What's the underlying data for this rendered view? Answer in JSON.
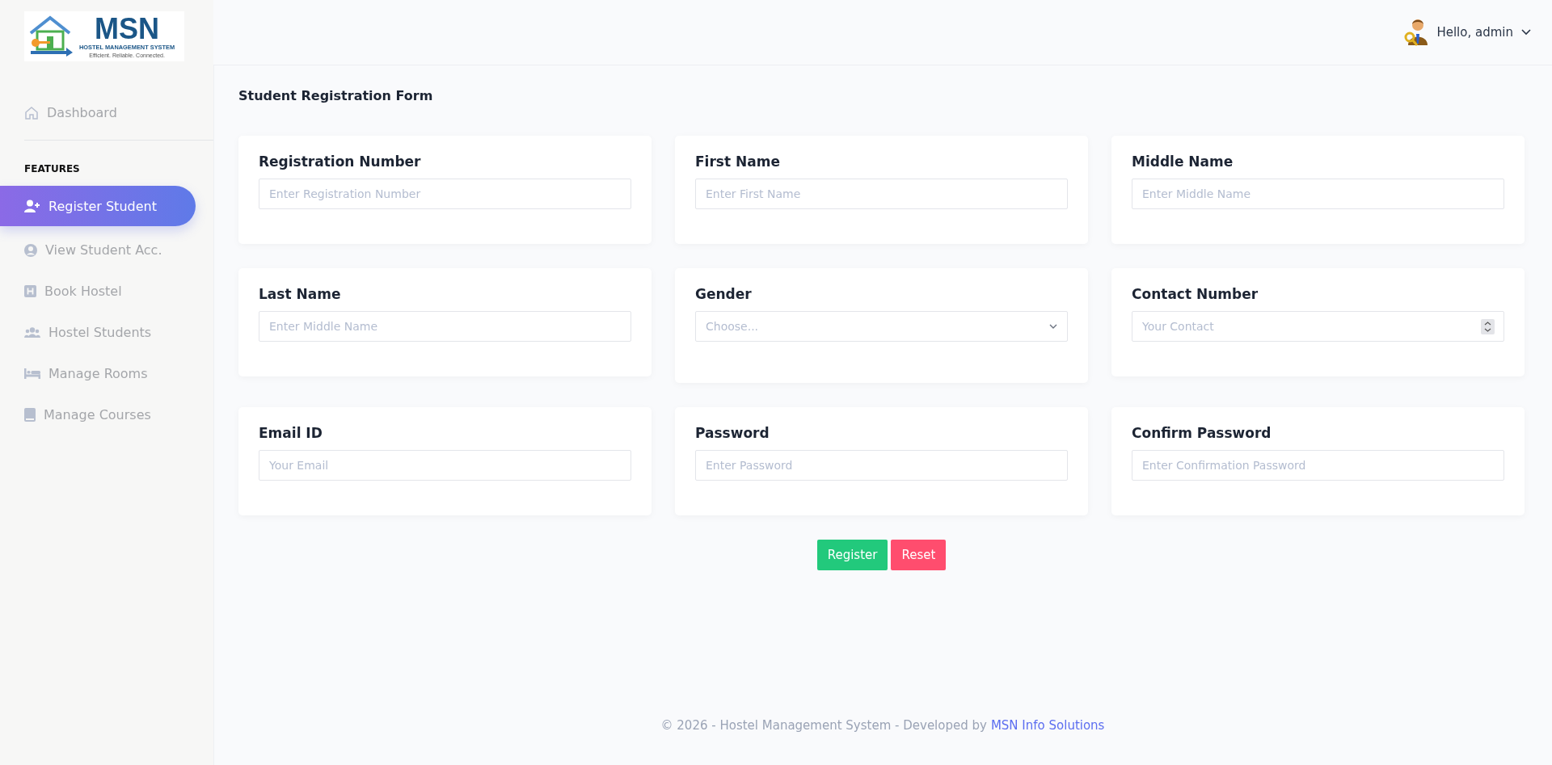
{
  "logo": {
    "title": "MSN",
    "subtitle": "HOSTEL MANAGEMENT SYSTEM",
    "tagline": "Efficient. Reliable. Connected."
  },
  "header": {
    "greeting": "Hello, admin"
  },
  "sidebar": {
    "top_items": [
      {
        "label": "Dashboard",
        "selected": false
      }
    ],
    "section_title": "FEATURES",
    "items": [
      {
        "label": "Register Student",
        "selected": true
      },
      {
        "label": "View Student Acc.",
        "selected": false
      },
      {
        "label": "Book Hostel",
        "selected": false
      },
      {
        "label": "Hostel Students",
        "selected": false
      },
      {
        "label": "Manage Rooms",
        "selected": false
      },
      {
        "label": "Manage Courses",
        "selected": false
      }
    ]
  },
  "page_title": "Student Registration Form",
  "fields": [
    {
      "label": "Registration Number",
      "kind": "text",
      "placeholder": "Enter Registration Number"
    },
    {
      "label": "First Name",
      "kind": "text",
      "placeholder": "Enter First Name"
    },
    {
      "label": "Middle Name",
      "kind": "text",
      "placeholder": "Enter Middle Name"
    },
    {
      "label": "Last Name",
      "kind": "text",
      "placeholder": "Enter Middle Name"
    },
    {
      "label": "Gender",
      "kind": "select",
      "placeholder": "Choose..."
    },
    {
      "label": "Contact Number",
      "kind": "number",
      "placeholder": "Your Contact"
    },
    {
      "label": "Email ID",
      "kind": "text",
      "placeholder": "Your Email"
    },
    {
      "label": "Password",
      "kind": "text",
      "placeholder": "Enter Password"
    },
    {
      "label": "Confirm Password",
      "kind": "text",
      "placeholder": "Enter Confirmation Password"
    }
  ],
  "buttons": [
    {
      "label": "Register",
      "kind": "primary"
    },
    {
      "label": "Reset",
      "kind": "danger"
    }
  ],
  "footer": {
    "text": "© 2026 - Hostel Management System - Developed by",
    "link": "MSN Info Solutions"
  }
}
